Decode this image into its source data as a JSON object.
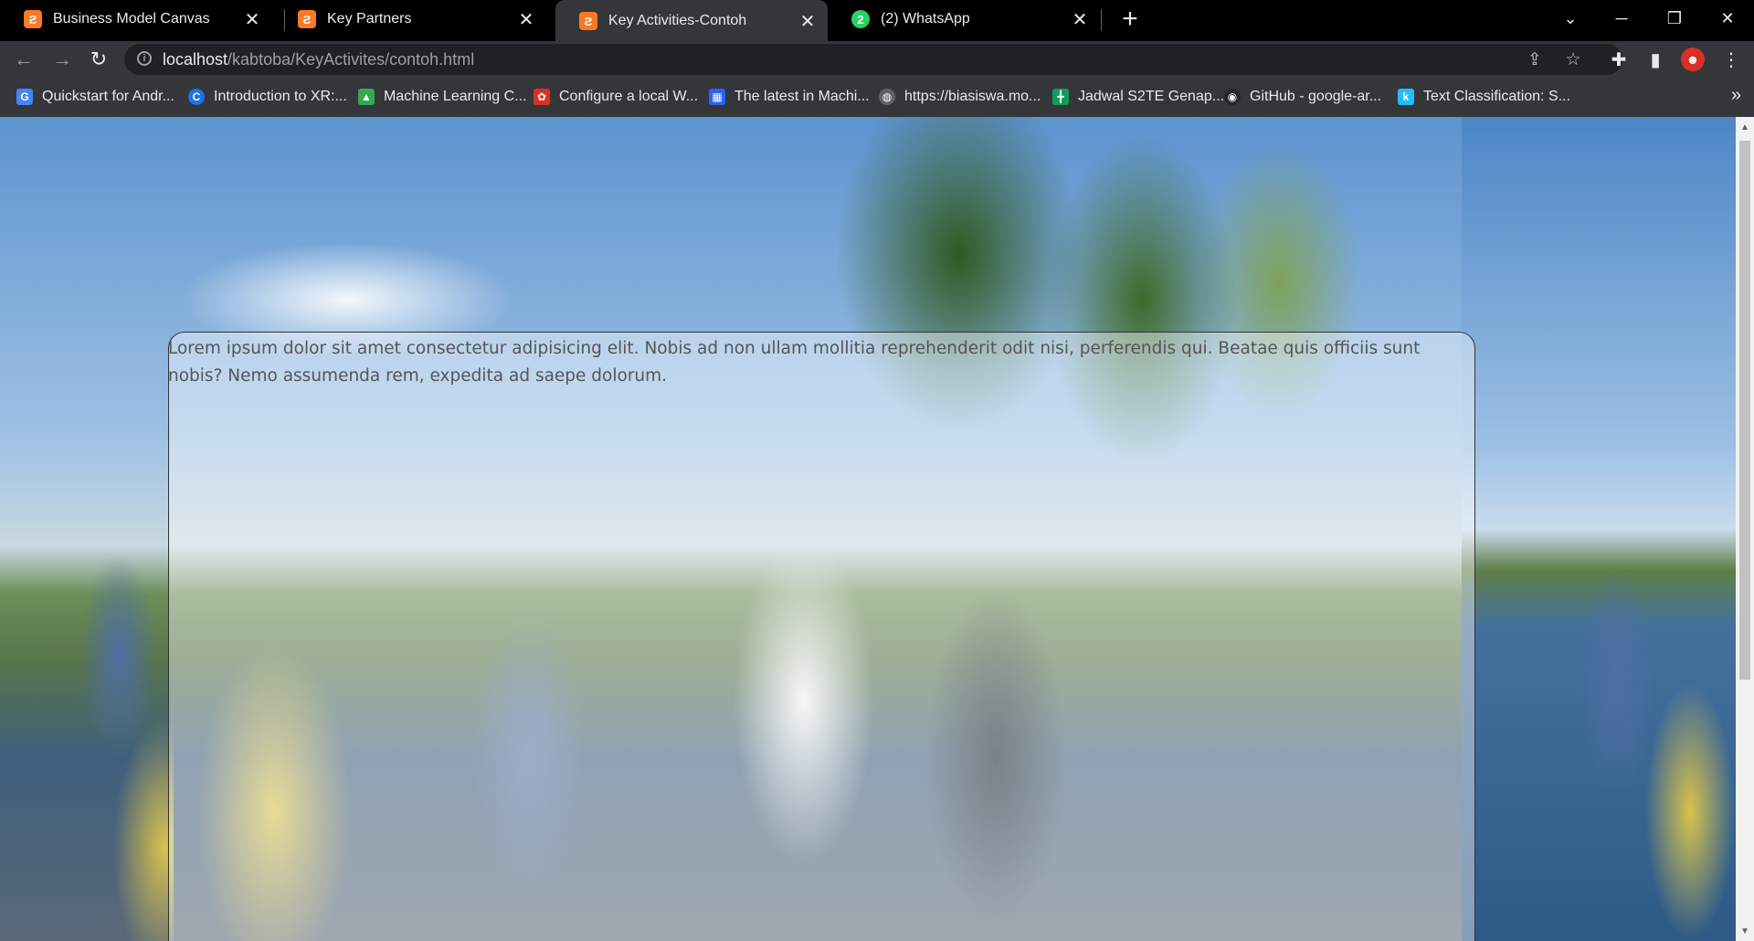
{
  "tabs": [
    {
      "title": "Business Model Canvas",
      "icon": "xampp-icon",
      "active": false
    },
    {
      "title": "Key Partners",
      "icon": "xampp-icon",
      "active": false
    },
    {
      "title": "Key Activities-Contoh",
      "icon": "xampp-icon",
      "active": true
    },
    {
      "title": "(2) WhatsApp",
      "icon": "whatsapp-icon",
      "active": false
    }
  ],
  "tab_close_glyph": "✕",
  "new_tab_glyph": "+",
  "window": {
    "tab_search_glyph": "⌄",
    "minimize_glyph": "─",
    "restore_glyph": "❐",
    "close_glyph": "✕"
  },
  "toolbar": {
    "back_glyph": "←",
    "forward_glyph": "→",
    "reload_glyph": "↻",
    "url_host": "localhost",
    "url_path": "/kabtoba/KeyActivites/contoh.html",
    "share_glyph": "⇪",
    "bookmark_star_glyph": "☆",
    "extensions_glyph": "✚",
    "sidepanel_glyph": "▮",
    "menu_glyph": "⋮"
  },
  "bookmarks": [
    {
      "label": "Quickstart for Andr...",
      "icon": "google-dev-icon",
      "color": "#4285f4"
    },
    {
      "label": "Introduction to XR:...",
      "icon": "coursera-icon",
      "color": "#1a73e8"
    },
    {
      "label": "Machine Learning C...",
      "icon": "google-drive-icon",
      "color": "#34a853"
    },
    {
      "label": "Configure a local W...",
      "icon": "red-logo-icon",
      "color": "#d93025"
    },
    {
      "label": "The latest in Machi...",
      "icon": "paperswithcode-icon",
      "color": "#2962ff"
    },
    {
      "label": "https://biasiswa.mo...",
      "icon": "globe-icon",
      "color": "#5f6368"
    },
    {
      "label": "Jadwal S2TE Genap...",
      "icon": "google-sheets-icon",
      "color": "#0f9d58"
    },
    {
      "label": "GitHub - google-ar...",
      "icon": "github-icon",
      "color": "#24292f"
    },
    {
      "label": "Text Classification: S...",
      "icon": "kaggle-icon",
      "color": "#20beff"
    }
  ],
  "bookmarks_more_glyph": "»",
  "page": {
    "paragraph": "Lorem ipsum dolor sit amet consectetur adipisicing elit. Nobis ad non ullam mollitia reprehenderit odit nisi, perferendis qui. Beatae quis officiis sunt nobis? Nemo assumenda rem, expedita ad saepe dolorum."
  },
  "scrollbar": {
    "position": 0.0,
    "up_glyph": "▲",
    "down_glyph": "▼"
  }
}
